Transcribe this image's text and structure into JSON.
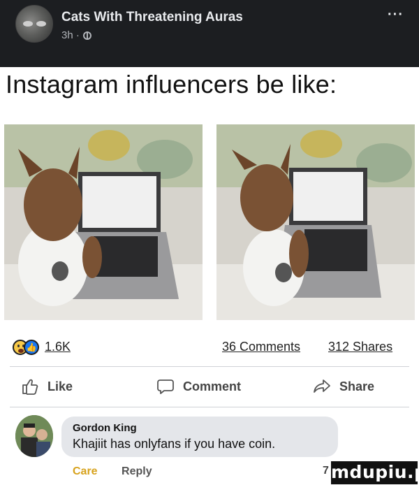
{
  "post": {
    "group_name": "Cats With Threatening Auras",
    "time": "3h ·",
    "more": "···",
    "caption": "Instagram influencers be like:"
  },
  "stats": {
    "reactions": "1.6K",
    "comments": "36 Comments",
    "shares": "312 Shares"
  },
  "actions": {
    "like": "Like",
    "comment": "Comment",
    "share": "Share"
  },
  "comment": {
    "author": "Gordon King",
    "text": "Khajiit has onlyfans if you have coin.",
    "reaction_label": "Care",
    "reply_label": "Reply",
    "partial_count": "7"
  },
  "watermark": "mdupiu.pl",
  "colors": {
    "header_bg": "#1c1e21",
    "like_blue": "#1877f2",
    "care_gold": "#d7a21c",
    "bubble_bg": "#e4e6ea"
  },
  "icons": [
    "globe-icon",
    "more-icon",
    "haha-reaction-icon",
    "like-reaction-icon",
    "thumbs-up-icon",
    "comment-icon",
    "share-icon"
  ]
}
